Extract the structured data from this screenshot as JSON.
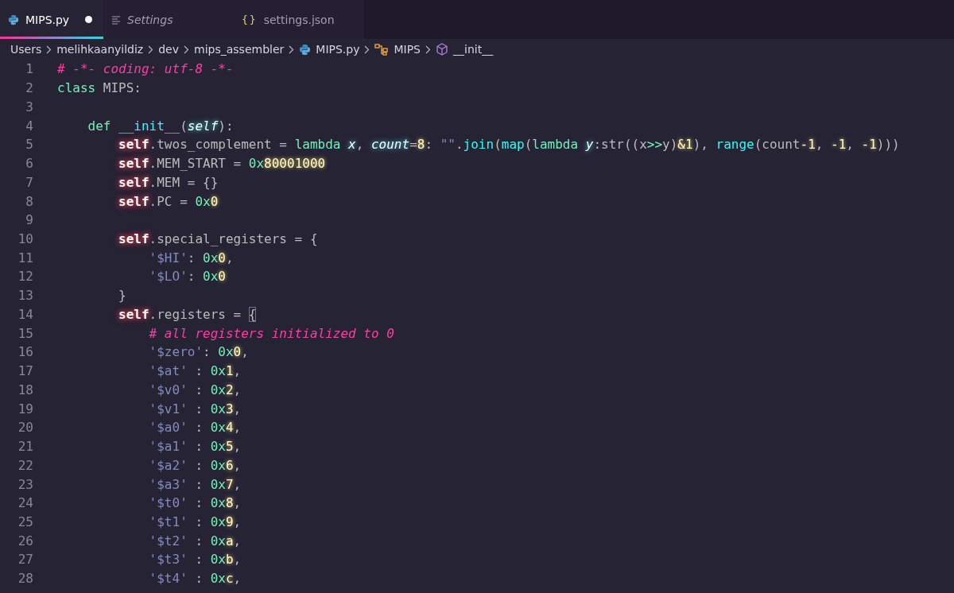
{
  "tabs": [
    {
      "label": "MIPS.py",
      "kind": "python",
      "selected": true,
      "modified": true,
      "preview": false
    },
    {
      "label": "Settings",
      "kind": "settings",
      "selected": false,
      "modified": false,
      "preview": true
    },
    {
      "label": "settings.json",
      "kind": "json",
      "glyph": "{}",
      "selected": false,
      "modified": false,
      "preview": false
    }
  ],
  "breadcrumbs": [
    {
      "label": "Users",
      "kind": "folder"
    },
    {
      "label": "melihkaanyildiz",
      "kind": "folder"
    },
    {
      "label": "dev",
      "kind": "folder"
    },
    {
      "label": "mips_assembler",
      "kind": "folder"
    },
    {
      "label": "MIPS.py",
      "kind": "python"
    },
    {
      "label": "MIPS",
      "kind": "class"
    },
    {
      "label": "__init__",
      "kind": "method"
    }
  ],
  "code": [
    {
      "number": "1",
      "tokens": [
        {
          "kind": "comment",
          "text": "# -*- coding: utf-8 -*-"
        }
      ]
    },
    {
      "number": "2",
      "tokens": [
        {
          "kind": "keyword",
          "text": "class"
        },
        {
          "kind": "plain",
          "text": " MIPS:"
        }
      ]
    },
    {
      "number": "3"
    },
    {
      "number": "4",
      "tokens": [
        {
          "kind": "keyword",
          "text": "    def"
        },
        {
          "kind": "func",
          "text": " __init__"
        },
        {
          "kind": "plain",
          "text": "("
        },
        {
          "kind": "param",
          "text": "self"
        },
        {
          "kind": "plain",
          "text": "):"
        }
      ]
    },
    {
      "number": "5",
      "tokens": [
        {
          "kind": "self",
          "text": "        self"
        },
        {
          "kind": "plain",
          "text": ".twos_complement = "
        },
        {
          "kind": "keyword",
          "text": "lambda "
        },
        {
          "kind": "param",
          "text": "x"
        },
        {
          "kind": "plain",
          "text": ", "
        },
        {
          "kind": "param",
          "text": "count"
        },
        {
          "kind": "plain",
          "text": "="
        },
        {
          "kind": "num",
          "text": "8"
        },
        {
          "kind": "plain",
          "text": ": "
        },
        {
          "kind": "string",
          "text": "\"\""
        },
        {
          "kind": "plain",
          "text": "."
        },
        {
          "kind": "func",
          "text": "join"
        },
        {
          "kind": "plain",
          "text": "("
        },
        {
          "kind": "func",
          "text": "map"
        },
        {
          "kind": "plain",
          "text": "("
        },
        {
          "kind": "keyword",
          "text": "lambda "
        },
        {
          "kind": "param",
          "text": "y"
        },
        {
          "kind": "plain",
          "text": ":str((x"
        },
        {
          "kind": "keyword",
          "text": ">>"
        },
        {
          "kind": "plain",
          "text": "y)"
        },
        {
          "kind": "num",
          "text": "&1"
        },
        {
          "kind": "plain",
          "text": "), "
        },
        {
          "kind": "func",
          "text": "range"
        },
        {
          "kind": "plain",
          "text": "(count"
        },
        {
          "kind": "num",
          "text": "-1"
        },
        {
          "kind": "plain",
          "text": ", "
        },
        {
          "kind": "num",
          "text": "-1"
        },
        {
          "kind": "plain",
          "text": ", "
        },
        {
          "kind": "num",
          "text": "-1"
        },
        {
          "kind": "plain",
          "text": ")))"
        }
      ]
    },
    {
      "number": "6",
      "tokens": [
        {
          "kind": "self",
          "text": "        self"
        },
        {
          "kind": "plain",
          "text": ".MEM_START = "
        },
        {
          "kind": "hex",
          "text": "0x"
        },
        {
          "kind": "num",
          "text": "80001000"
        }
      ]
    },
    {
      "number": "7",
      "tokens": [
        {
          "kind": "self",
          "text": "        self"
        },
        {
          "kind": "plain",
          "text": ".MEM = {}"
        }
      ]
    },
    {
      "number": "8",
      "tokens": [
        {
          "kind": "self",
          "text": "        self"
        },
        {
          "kind": "plain",
          "text": ".PC = "
        },
        {
          "kind": "hex",
          "text": "0x"
        },
        {
          "kind": "num",
          "text": "0"
        }
      ]
    },
    {
      "number": "9"
    },
    {
      "number": "10",
      "tokens": [
        {
          "kind": "self",
          "text": "        self"
        },
        {
          "kind": "plain",
          "text": ".special_registers = {"
        }
      ]
    },
    {
      "number": "11",
      "tokens": [
        {
          "kind": "string",
          "text": "            '$HI'"
        },
        {
          "kind": "plain",
          "text": ": "
        },
        {
          "kind": "hex",
          "text": "0x"
        },
        {
          "kind": "num",
          "text": "0"
        },
        {
          "kind": "plain",
          "text": ","
        }
      ]
    },
    {
      "number": "12",
      "tokens": [
        {
          "kind": "string",
          "text": "            '$LO'"
        },
        {
          "kind": "plain",
          "text": ": "
        },
        {
          "kind": "hex",
          "text": "0x"
        },
        {
          "kind": "num",
          "text": "0"
        }
      ]
    },
    {
      "number": "13",
      "tokens": [
        {
          "kind": "plain",
          "text": "        }"
        }
      ]
    },
    {
      "number": "14",
      "tokens": [
        {
          "kind": "self",
          "text": "        self"
        },
        {
          "kind": "plain",
          "text": ".registers = "
        },
        {
          "kind": "match",
          "text": "{"
        }
      ]
    },
    {
      "number": "15",
      "tokens": [
        {
          "kind": "comment",
          "text": "            # all registers initialized to 0"
        }
      ]
    },
    {
      "number": "16",
      "tokens": [
        {
          "kind": "string",
          "text": "            '$zero'"
        },
        {
          "kind": "plain",
          "text": ": "
        },
        {
          "kind": "hex",
          "text": "0x"
        },
        {
          "kind": "num",
          "text": "0"
        },
        {
          "kind": "plain",
          "text": ","
        }
      ]
    },
    {
      "number": "17",
      "tokens": [
        {
          "kind": "string",
          "text": "            '$at'"
        },
        {
          "kind": "plain",
          "text": " : "
        },
        {
          "kind": "hex",
          "text": "0x"
        },
        {
          "kind": "num",
          "text": "1"
        },
        {
          "kind": "plain",
          "text": ","
        }
      ]
    },
    {
      "number": "18",
      "tokens": [
        {
          "kind": "string",
          "text": "            '$v0'"
        },
        {
          "kind": "plain",
          "text": " : "
        },
        {
          "kind": "hex",
          "text": "0x"
        },
        {
          "kind": "num",
          "text": "2"
        },
        {
          "kind": "plain",
          "text": ","
        }
      ]
    },
    {
      "number": "19",
      "tokens": [
        {
          "kind": "string",
          "text": "            '$v1'"
        },
        {
          "kind": "plain",
          "text": " : "
        },
        {
          "kind": "hex",
          "text": "0x"
        },
        {
          "kind": "num",
          "text": "3"
        },
        {
          "kind": "plain",
          "text": ","
        }
      ]
    },
    {
      "number": "20",
      "tokens": [
        {
          "kind": "string",
          "text": "            '$a0'"
        },
        {
          "kind": "plain",
          "text": " : "
        },
        {
          "kind": "hex",
          "text": "0x"
        },
        {
          "kind": "num",
          "text": "4"
        },
        {
          "kind": "plain",
          "text": ","
        }
      ]
    },
    {
      "number": "21",
      "tokens": [
        {
          "kind": "string",
          "text": "            '$a1'"
        },
        {
          "kind": "plain",
          "text": " : "
        },
        {
          "kind": "hex",
          "text": "0x"
        },
        {
          "kind": "num",
          "text": "5"
        },
        {
          "kind": "plain",
          "text": ","
        }
      ]
    },
    {
      "number": "22",
      "tokens": [
        {
          "kind": "string",
          "text": "            '$a2'"
        },
        {
          "kind": "plain",
          "text": " : "
        },
        {
          "kind": "hex",
          "text": "0x"
        },
        {
          "kind": "num",
          "text": "6"
        },
        {
          "kind": "plain",
          "text": ","
        }
      ]
    },
    {
      "number": "23",
      "tokens": [
        {
          "kind": "string",
          "text": "            '$a3'"
        },
        {
          "kind": "plain",
          "text": " : "
        },
        {
          "kind": "hex",
          "text": "0x"
        },
        {
          "kind": "num",
          "text": "7"
        },
        {
          "kind": "plain",
          "text": ","
        }
      ]
    },
    {
      "number": "24",
      "tokens": [
        {
          "kind": "string",
          "text": "            '$t0'"
        },
        {
          "kind": "plain",
          "text": " : "
        },
        {
          "kind": "hex",
          "text": "0x"
        },
        {
          "kind": "num",
          "text": "8"
        },
        {
          "kind": "plain",
          "text": ","
        }
      ]
    },
    {
      "number": "25",
      "tokens": [
        {
          "kind": "string",
          "text": "            '$t1'"
        },
        {
          "kind": "plain",
          "text": " : "
        },
        {
          "kind": "hex",
          "text": "0x"
        },
        {
          "kind": "num",
          "text": "9"
        },
        {
          "kind": "plain",
          "text": ","
        }
      ]
    },
    {
      "number": "26",
      "tokens": [
        {
          "kind": "string",
          "text": "            '$t2'"
        },
        {
          "kind": "plain",
          "text": " : "
        },
        {
          "kind": "hex",
          "text": "0x"
        },
        {
          "kind": "num",
          "text": "a"
        },
        {
          "kind": "plain",
          "text": ","
        }
      ]
    },
    {
      "number": "27",
      "tokens": [
        {
          "kind": "string",
          "text": "            '$t3'"
        },
        {
          "kind": "plain",
          "text": " : "
        },
        {
          "kind": "hex",
          "text": "0x"
        },
        {
          "kind": "num",
          "text": "b"
        },
        {
          "kind": "plain",
          "text": ","
        }
      ]
    },
    {
      "number": "28",
      "tokens": [
        {
          "kind": "string",
          "text": "            '$t4'"
        },
        {
          "kind": "plain",
          "text": " : "
        },
        {
          "kind": "hex",
          "text": "0x"
        },
        {
          "kind": "num",
          "text": "c"
        },
        {
          "kind": "plain",
          "text": ","
        }
      ]
    }
  ]
}
